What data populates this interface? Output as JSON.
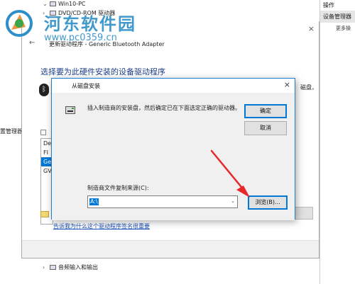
{
  "device_manager": {
    "tree_top": "Win10-PC",
    "tree_dvd": "DVD/CD-ROM 驱动器",
    "tree_audio": "音频输入和输出",
    "left_pane_text": "置管理器"
  },
  "actions_pane": {
    "header": "操作",
    "selected_item": "设备管理器",
    "more": "更多操"
  },
  "wizard": {
    "title": "更新驱动程序 - Generic Bluetooth Adapter",
    "heading": "选择要为此硬件安装的设备驱动程序",
    "disk_text": "磁盘，",
    "list_items": [
      "De",
      "FI",
      "Ge",
      "GV"
    ],
    "selected_index": 2,
    "link": "告诉我为什么这个驱动程序签名很重要"
  },
  "dialog": {
    "title": "从磁盘安装",
    "message": "插入制造商的安装盘，然后确定已在下面选定正确的驱动器。",
    "ok_label": "确定",
    "cancel_label": "取消",
    "copy_from_label": "制造商文件复制来源(C):",
    "copy_from_value": "A:\\",
    "browse_label": "浏览(B)..."
  },
  "watermark": {
    "title": "河东软件园",
    "url": "www.pc0359.cn"
  },
  "colors": {
    "accent": "#0078d7",
    "heading": "#1e3d8a",
    "arrow": "#e8272b",
    "watermark": "#2e8ec7"
  }
}
